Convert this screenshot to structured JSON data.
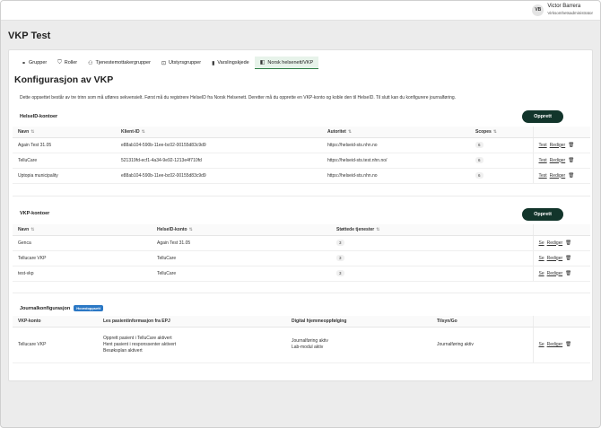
{
  "user": {
    "initials": "VB",
    "name": "Victor Barrera",
    "role": "Virksomhetsadministrator"
  },
  "page": {
    "title": "VKP Test"
  },
  "tabs": [
    {
      "label": "Grupper",
      "icon": "group-icon"
    },
    {
      "label": "Roller",
      "icon": "shield-icon"
    },
    {
      "label": "Tjenestemottakergrupper",
      "icon": "users-icon"
    },
    {
      "label": "Utstyrsgrupper",
      "icon": "device-icon"
    },
    {
      "label": "Varslingskjede",
      "icon": "bell-icon"
    },
    {
      "label": "Norsk helsenett/VKP",
      "icon": "network-icon"
    }
  ],
  "section": {
    "title": "Konfigurasjon av VKP",
    "intro": "Dette oppsettet består av tre trinn som må utføres sekvensielt. Først må du registrere HelseID fra Norsk Helsenett. Deretter må du opprette en VKP-konto og koble den til HelseID. Til slutt kan du konfigurere journalføring."
  },
  "helseid": {
    "title": "HelseID-kontoer",
    "create_label": "Opprett",
    "columns": [
      "Navn",
      "Klient-ID",
      "Autoritet",
      "Scopes"
    ],
    "rows": [
      {
        "name": "Again Test 31.05",
        "client_id": "e88ab104-590b-11ee-bc02-00155d83c9d9",
        "authority": "https://helseid-sts.nhn.no",
        "scopes": "6"
      },
      {
        "name": "TelluCare",
        "client_id": "521319fd-ecf1-4a34-9e92-1213e4f710fd",
        "authority": "https://helseid-sts.test.nhn.no/",
        "scopes": "6"
      },
      {
        "name": "Uptopia municipality",
        "client_id": "e88ab104-590b-11ee-bc02-00155d83c9d9",
        "authority": "https://helseid-sts.nhn.no",
        "scopes": "6"
      }
    ],
    "actions": {
      "test": "Test",
      "edit": "Rediger"
    }
  },
  "vkp": {
    "title": "VKP-kontoer",
    "create_label": "Opprett",
    "columns": [
      "Navn",
      "HelseID-konto",
      "Støttede tjenester"
    ],
    "rows": [
      {
        "name": "Genca",
        "helseid": "Again Test 31.05",
        "services": "3"
      },
      {
        "name": "Tellucare VKP",
        "helseid": "TelluCare",
        "services": "3"
      },
      {
        "name": "test-vkp",
        "helseid": "TelluCare",
        "services": "3"
      }
    ],
    "actions": {
      "view": "Se",
      "edit": "Rediger"
    }
  },
  "journal": {
    "title": "Journalkonfigurasjon",
    "badge": "Hovedoppsett",
    "columns": [
      "VKP-konto",
      "Les pasientinformasjon fra EPJ",
      "Digital hjemmeoppfølging",
      "Tilsyn/Go"
    ],
    "row": {
      "account": "Tellucare VKP",
      "epj": [
        "Opprett pasient i TelluCare aktivert",
        "Hent pasient i responssenter aktivert",
        "Besøksplan aktivert"
      ],
      "digital": [
        "Journalføring aktiv",
        "Lab-modul aktiv"
      ],
      "tilsyn": "Journalføring aktiv"
    },
    "actions": {
      "view": "Se",
      "edit": "Rediger"
    }
  }
}
